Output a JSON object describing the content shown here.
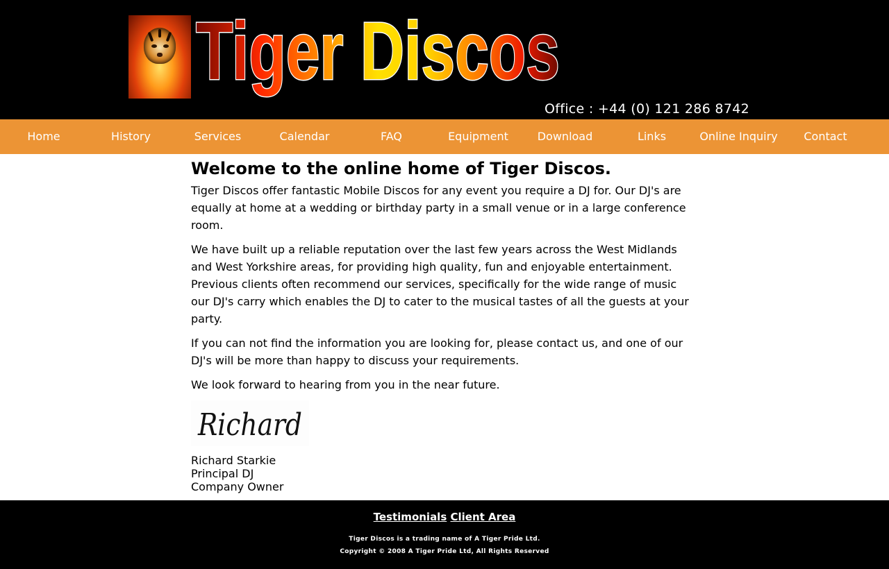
{
  "header": {
    "logo_text": "Tiger Discos",
    "office_phone": "Office : +44 (0) 121 286 8742"
  },
  "nav": {
    "items": [
      {
        "label": "Home"
      },
      {
        "label": "History"
      },
      {
        "label": "Services"
      },
      {
        "label": "Calendar"
      },
      {
        "label": "FAQ"
      },
      {
        "label": "Equipment"
      },
      {
        "label": "Download"
      },
      {
        "label": "Links"
      },
      {
        "label": "Online Inquiry"
      },
      {
        "label": "Contact"
      }
    ]
  },
  "main": {
    "title": "Welcome to the online home of Tiger Discos.",
    "paragraphs": [
      "Tiger Discos offer fantastic Mobile Discos for any event you require a DJ for. Our DJ's are equally at home at a wedding or birthday party in a small venue or in a large conference room.",
      "We have built up a reliable reputation over the last few years across the West Midlands and West Yorkshire areas, for providing high quality, fun and enjoyable entertainment. Previous clients often recommend our services, specifically for the wide range of music our DJ's carry which enables the DJ to cater to the musical tastes of all the guests at your party.",
      "If you can not find the information you are looking for, please contact us, and one of our DJ's will be more than happy to discuss your requirements.",
      "We look forward to hearing from you in the near future."
    ],
    "signature_text": "Richard",
    "signoff": {
      "name": "Richard Starkie",
      "role": "Principal DJ",
      "title": "Company Owner"
    }
  },
  "footer": {
    "links": [
      {
        "label": "Testimonials"
      },
      {
        "label": "Client Area"
      }
    ],
    "trading_name": "Tiger Discos is a trading name of A Tiger Pride Ltd.",
    "copyright": "Copyright © 2008 A Tiger Pride Ltd, All Rights Reserved"
  },
  "colors": {
    "header_bg": "#000000",
    "nav_bg": "#ec9435",
    "nav_text": "#ffffff",
    "footer_bg": "#000000"
  }
}
